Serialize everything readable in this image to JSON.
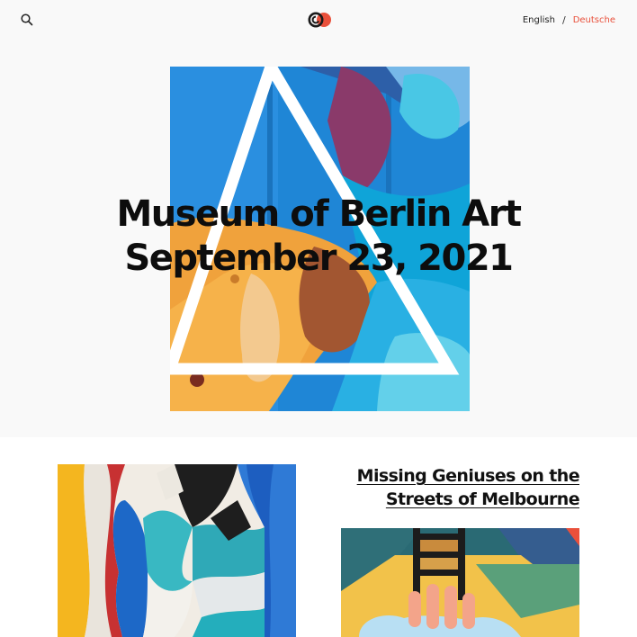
{
  "header": {
    "search_icon": "search-icon",
    "logo_icon": "logo-mark",
    "languages": {
      "english": "English",
      "separator": "/",
      "german": "Deutsche"
    },
    "active_language_color": "#e9503b"
  },
  "hero": {
    "title_line1": "Museum of Berlin Art",
    "title_line2": "September 23, 2021"
  },
  "articles": [
    {
      "title_line1": "Missing Geniuses on the",
      "title_line2": "Streets of Melbourne"
    }
  ],
  "colors": {
    "hero_background": "#f9f9f9",
    "accent": "#e9503b"
  }
}
